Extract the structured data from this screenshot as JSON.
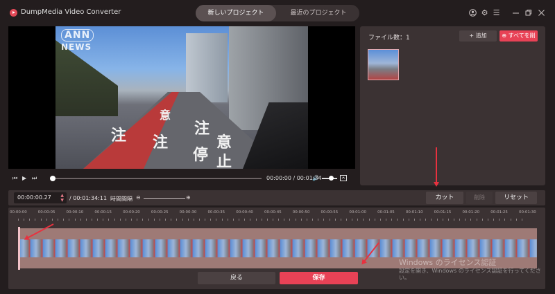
{
  "app": {
    "title": "DumpMedia Video Converter",
    "tabs": [
      {
        "label": "新しいプロジェクト",
        "active": true
      },
      {
        "label": "最近のプロジェクト",
        "active": false
      }
    ],
    "window_icons": [
      "user-icon",
      "gear-icon",
      "menu-icon",
      "minimize-icon",
      "maximize-icon",
      "close-icon"
    ]
  },
  "video": {
    "watermark_line1": "ANN",
    "watermark_line2": "NEWS",
    "road_text": [
      "注",
      "注",
      "意",
      "注",
      "意",
      "停",
      "止"
    ],
    "progress": 0.0
  },
  "player": {
    "current_time": "00:00:00",
    "total_time": "00:01:34",
    "time_display": "00:00:00 / 00:01:34",
    "volume": 0.6
  },
  "files": {
    "count_label": "ファイル数：1",
    "add_label": "+ 追加",
    "delete_all_label": "すべてを削",
    "items": [
      {
        "thumbnail": "road-scene"
      }
    ]
  },
  "cut_toolbar": {
    "start_time": "00:00:00.27",
    "duration": "/ 00:01:34:11",
    "interval_label": "時間間隔",
    "cut_label": "カット",
    "delete_label": "削除",
    "reset_label": "リセット"
  },
  "timeline": {
    "ticks": [
      "00:00:00",
      "00:00:05",
      "00:00:10",
      "00:00:15",
      "00:00:20",
      "00:00:25",
      "00:00:30",
      "00:00:35",
      "00:00:40",
      "00:00:45",
      "00:00:50",
      "00:00:55",
      "00:01:00",
      "00:01:05",
      "00:01:10",
      "00:01:15",
      "00:01:20",
      "00:01:25",
      "00:01:30"
    ],
    "back_label": "戻る",
    "save_label": "保存"
  },
  "system_watermark": {
    "title": "Windows のライセンス認証",
    "body": "設定を開き、Windows のライセンス認証を行ってください。"
  },
  "colors": {
    "accent": "#e84256",
    "background": "#231d1e",
    "panel": "#3b3233",
    "annotation_arrow": "#e8313f"
  }
}
